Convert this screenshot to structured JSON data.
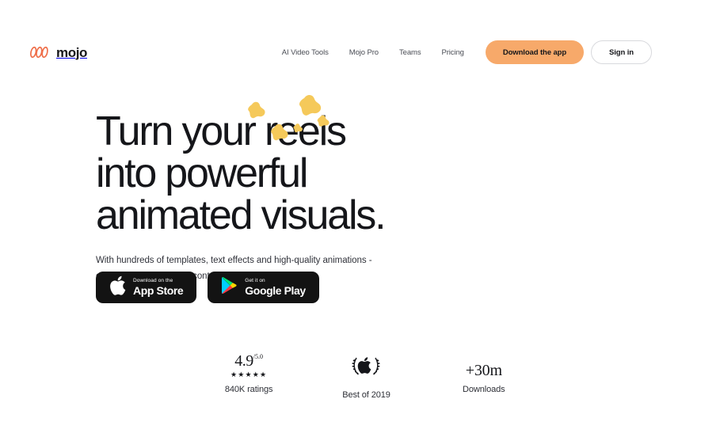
{
  "brand": {
    "name": "mojo",
    "mark_icon": "mojo-loops-icon",
    "mark_color": "#ef6f4a"
  },
  "nav": {
    "links": [
      {
        "label": "AI Video Tools"
      },
      {
        "label": "Mojo Pro"
      },
      {
        "label": "Teams"
      },
      {
        "label": "Pricing"
      }
    ],
    "download_label": "Download the app",
    "signin_label": "Sign in",
    "download_bg": "#f7a96a"
  },
  "hero": {
    "headline_line1_pre": "Turn your ",
    "headline_line1_word": "reels",
    "headline_line2": "into powerful",
    "headline_line3": "animated visuals.",
    "sparkle_color": "#f5c95a",
    "subhead_line1": "With hundreds of templates, text effects and high-quality animations -",
    "subhead_line2": "creating stunning social content has never been easier."
  },
  "stores": {
    "apple": {
      "icon": "apple-logo-icon",
      "top_label": "Download on the",
      "bottom_label": "App Store"
    },
    "google": {
      "icon": "google-play-icon",
      "top_label": "Get it on",
      "bottom_label": "Google Play"
    }
  },
  "stats": {
    "rating": {
      "value": "4.9",
      "max": "/5.0",
      "stars": "★★★★★",
      "caption": "840K ratings"
    },
    "award": {
      "icon": "apple-laurel-award-icon",
      "caption": "Best of 2019"
    },
    "downloads": {
      "value": "+30m",
      "caption": "Downloads"
    }
  }
}
